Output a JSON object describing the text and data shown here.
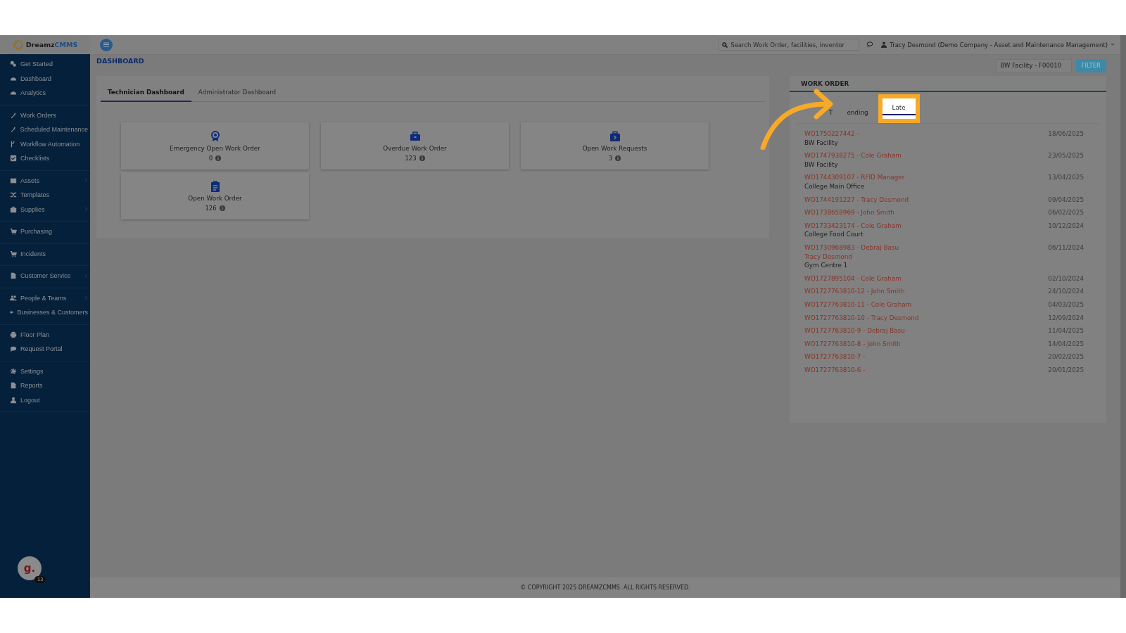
{
  "logo": {
    "part1": "Dreamz",
    "part2": "CMMS"
  },
  "sidebar": {
    "groups": [
      [
        {
          "label": "Get Started",
          "submenu": false
        },
        {
          "label": "Dashboard",
          "submenu": false
        },
        {
          "label": "Analytics",
          "submenu": false
        }
      ],
      [
        {
          "label": "Work Orders",
          "submenu": false
        },
        {
          "label": "Scheduled Maintenance",
          "submenu": false
        },
        {
          "label": "Workflow Automation",
          "submenu": false
        },
        {
          "label": "Checklists",
          "submenu": false
        }
      ],
      [
        {
          "label": "Assets",
          "submenu": true
        },
        {
          "label": "Templates",
          "submenu": false
        },
        {
          "label": "Supplies",
          "submenu": true
        }
      ],
      [
        {
          "label": "Purchasing",
          "submenu": false
        }
      ],
      [
        {
          "label": "Incidents",
          "submenu": false
        }
      ],
      [
        {
          "label": "Customer Service",
          "submenu": true
        }
      ],
      [
        {
          "label": "People & Teams",
          "submenu": true
        },
        {
          "label": "Businesses & Customers",
          "submenu": false
        }
      ],
      [
        {
          "label": "Floor Plan",
          "submenu": false
        },
        {
          "label": "Request Portal",
          "submenu": false
        }
      ],
      [
        {
          "label": "Settings",
          "submenu": false
        },
        {
          "label": "Reports",
          "submenu": false
        },
        {
          "label": "Logout",
          "submenu": false
        }
      ]
    ],
    "avatar": {
      "letter": "g.",
      "badge": "13"
    }
  },
  "topbar": {
    "search": {
      "placeholder": "Search Work Order, facilities, inventor"
    },
    "user": "Tracy Desmond (Demo Company - Asset and Maintenance Management)"
  },
  "page_title": "DASHBOARD",
  "filter": {
    "value": "BW Facility - F00010",
    "button": "FILTER"
  },
  "dashboard_tabs": [
    {
      "label": "Technician Dashboard",
      "selected": true
    },
    {
      "label": "Administrator Dashboard",
      "selected": false
    }
  ],
  "cards": [
    {
      "title": "Emergency Open Work Order",
      "count": "0"
    },
    {
      "title": "Overdue Work Order",
      "count": "123"
    },
    {
      "title": "Open Work Requests",
      "count": "3"
    },
    {
      "title": "Open Work Order",
      "count": "126"
    }
  ],
  "work_order": {
    "title": "WORK ORDER",
    "tabs": [
      {
        "label": "T",
        "selected": false,
        "highlighted": false
      },
      {
        "label": "ending",
        "selected": false,
        "highlighted": false
      },
      {
        "label": "Late",
        "selected": true,
        "highlighted": true
      }
    ],
    "rows": [
      {
        "links": [
          "WO1750227442 -"
        ],
        "location": "BW Facility",
        "date": "18/06/2025"
      },
      {
        "links": [
          "WO1747938275 - Cole Graham"
        ],
        "location": "BW Facility",
        "date": "23/05/2025"
      },
      {
        "links": [
          "WO1744309107 - RFID Manager"
        ],
        "location": "College Main Office",
        "date": "13/04/2025"
      },
      {
        "links": [
          "WO1744191227 - Tracy Desmond"
        ],
        "date": "09/04/2025"
      },
      {
        "links": [
          "WO1738658969 - John Smith"
        ],
        "date": "06/02/2025"
      },
      {
        "links": [
          "WO1733423174 - Cole Graham"
        ],
        "location": "College Food Court",
        "date": "10/12/2024"
      },
      {
        "links": [
          "WO1730968983 - Debraj Basu",
          "Tracy Desmond"
        ],
        "location": "Gym Centre 1",
        "date": "06/11/2024"
      },
      {
        "links": [
          "WO1727895104 - Cole Graham"
        ],
        "date": "02/10/2024"
      },
      {
        "links": [
          "WO1727763810-12 - John Smith"
        ],
        "date": "24/10/2024"
      },
      {
        "links": [
          "WO1727763810-11 - Cole Graham"
        ],
        "date": "04/03/2025"
      },
      {
        "links": [
          "WO1727763810-10 - Tracy Desmond"
        ],
        "date": "12/09/2024"
      },
      {
        "links": [
          "WO1727763810-9 - Debraj Basu"
        ],
        "date": "11/04/2025"
      },
      {
        "links": [
          "WO1727763810-8 - John Smith"
        ],
        "date": "14/04/2025"
      },
      {
        "links": [
          "WO1727763810-7 -"
        ],
        "date": "20/02/2025"
      },
      {
        "links": [
          "WO1727763810-6 -"
        ],
        "date": "20/01/2025"
      }
    ]
  },
  "footer": "© COPYRIGHT 2025 DREAMZCMMS. ALL RIGHTS RESERVED."
}
